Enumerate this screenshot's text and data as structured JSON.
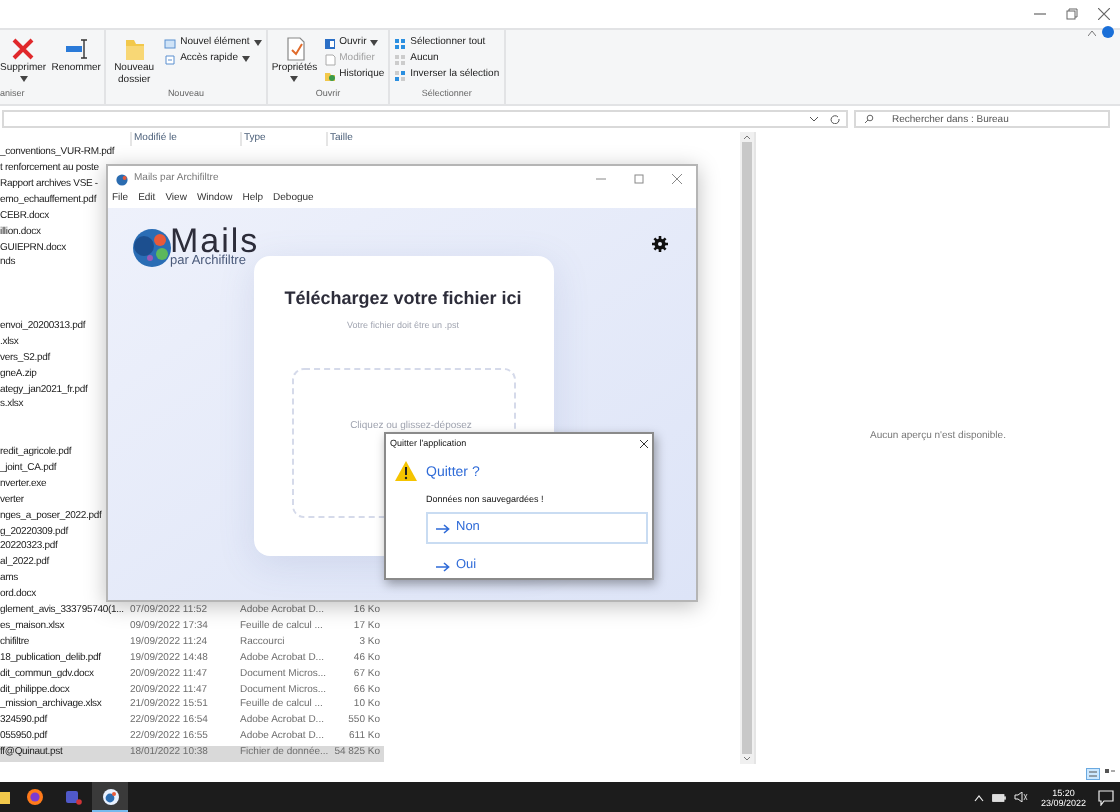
{
  "explorer": {
    "ribbon": {
      "groups": [
        {
          "label": "aniser",
          "large": [
            {
              "label": "Supprimer",
              "menu": true
            },
            {
              "label": "Renommer",
              "menu": false
            }
          ]
        },
        {
          "label": "Nouveau",
          "large": [
            {
              "label": "Nouveau dossier",
              "menu": false
            }
          ],
          "small": [
            {
              "label": "Nouvel élément",
              "menu": true,
              "disabled": false
            },
            {
              "label": "Accès rapide",
              "menu": true,
              "disabled": false
            }
          ]
        },
        {
          "label": "Ouvrir",
          "large": [
            {
              "label": "Propriétés",
              "menu": true
            }
          ],
          "small": [
            {
              "label": "Ouvrir",
              "menu": true,
              "disabled": false
            },
            {
              "label": "Modifier",
              "menu": false,
              "disabled": true
            },
            {
              "label": "Historique",
              "menu": false,
              "disabled": false
            }
          ]
        },
        {
          "label": "Sélectionner",
          "small": [
            {
              "label": "Sélectionner tout",
              "menu": false,
              "disabled": false
            },
            {
              "label": "Aucun",
              "menu": false,
              "disabled": false
            },
            {
              "label": "Inverser la sélection",
              "menu": false,
              "disabled": false
            }
          ]
        }
      ]
    },
    "search": {
      "placeholder": "Rechercher dans : Bureau"
    },
    "columns": [
      "Modifié le",
      "Type",
      "Taille"
    ],
    "file_groups": [
      [
        {
          "name": "_conventions_VUR-RM.pdf",
          "selected": false
        },
        {
          "name": "t renforcement au poste",
          "selected": false
        },
        {
          "name": "Rapport archives VSE -",
          "selected": false
        },
        {
          "name": "emo_echauffement.pdf",
          "selected": false
        },
        {
          "name": "CEBR.docx",
          "selected": false
        },
        {
          "name": "illion.docx",
          "selected": false
        },
        {
          "name": "GUIEPRN.docx",
          "selected": false
        },
        {
          "name": "nds",
          "selected": false
        }
      ],
      [
        {
          "name": "envoi_20200313.pdf",
          "selected": false
        },
        {
          "name": ".xlsx",
          "selected": false
        },
        {
          "name": "vers_S2.pdf",
          "selected": false
        },
        {
          "name": "gneA.zip",
          "selected": false
        },
        {
          "name": "ategy_jan2021_fr.pdf",
          "selected": false
        },
        {
          "name": "s.xlsx",
          "selected": false
        }
      ],
      [
        {
          "name": "redit_agricole.pdf",
          "selected": false
        },
        {
          "name": "_joint_CA.pdf",
          "selected": false
        },
        {
          "name": "nverter.exe",
          "selected": false
        },
        {
          "name": "verter",
          "selected": false
        },
        {
          "name": "nges_a_poser_2022.pdf",
          "selected": false
        },
        {
          "name": "g_20220309.pdf",
          "selected": false
        },
        {
          "name": "20220323.pdf",
          "selected": false
        },
        {
          "name": "al_2022.pdf",
          "selected": false
        },
        {
          "name": "ams",
          "selected": false
        },
        {
          "name": "ord.docx",
          "selected": false
        },
        {
          "name": "glement_avis_333795740(1...",
          "modified": "07/09/2022 11:52",
          "type": "Adobe Acrobat D...",
          "size": "16 Ko",
          "selected": false
        },
        {
          "name": "es_maison.xlsx",
          "modified": "09/09/2022 17:34",
          "type": "Feuille de calcul ...",
          "size": "17 Ko",
          "selected": false
        },
        {
          "name": "chifiltre",
          "modified": "19/09/2022 11:24",
          "type": "Raccourci",
          "size": "3 Ko",
          "selected": false
        },
        {
          "name": "18_publication_delib.pdf",
          "modified": "19/09/2022 14:48",
          "type": "Adobe Acrobat D...",
          "size": "46 Ko",
          "selected": false
        },
        {
          "name": "dit_commun_gdv.docx",
          "modified": "20/09/2022 11:47",
          "type": "Document Micros...",
          "size": "67 Ko",
          "selected": false
        },
        {
          "name": "dit_philippe.docx",
          "modified": "20/09/2022 11:47",
          "type": "Document Micros...",
          "size": "66 Ko",
          "selected": false
        },
        {
          "name": "_mission_archivage.xlsx",
          "modified": "21/09/2022 15:51",
          "type": "Feuille de calcul ...",
          "size": "10 Ko",
          "selected": false
        },
        {
          "name": "324590.pdf",
          "modified": "22/09/2022 16:54",
          "type": "Adobe Acrobat D...",
          "size": "550 Ko",
          "selected": false
        },
        {
          "name": "055950.pdf",
          "modified": "22/09/2022 16:55",
          "type": "Adobe Acrobat D...",
          "size": "611 Ko",
          "selected": false
        },
        {
          "name": "ff@Quinaut.pst",
          "modified": "18/01/2022 10:38",
          "type": "Fichier de donnée...",
          "size": "54 825 Ko",
          "selected": true
        }
      ]
    ],
    "preview": "Aucun aperçu n'est disponible."
  },
  "app": {
    "title": "Mails par Archifiltre",
    "menu": [
      "File",
      "Edit",
      "View",
      "Window",
      "Help",
      "Debogue"
    ],
    "logo": {
      "name": "Mails",
      "tagline": "par Archifiltre"
    },
    "upload": {
      "title": "Téléchargez votre fichier ici",
      "subtitle": "Votre fichier doit être un .pst",
      "dropzone": "Cliquez ou glissez-déposez"
    }
  },
  "dialog": {
    "title": "Quitter l'application",
    "heading": "Quitter ?",
    "message": "Données non sauvegardées !",
    "buttons": [
      {
        "label": "Non",
        "focused": true
      },
      {
        "label": "Oui",
        "focused": false
      }
    ]
  },
  "taskbar": {
    "time": "15:20",
    "date": "23/09/2022"
  }
}
